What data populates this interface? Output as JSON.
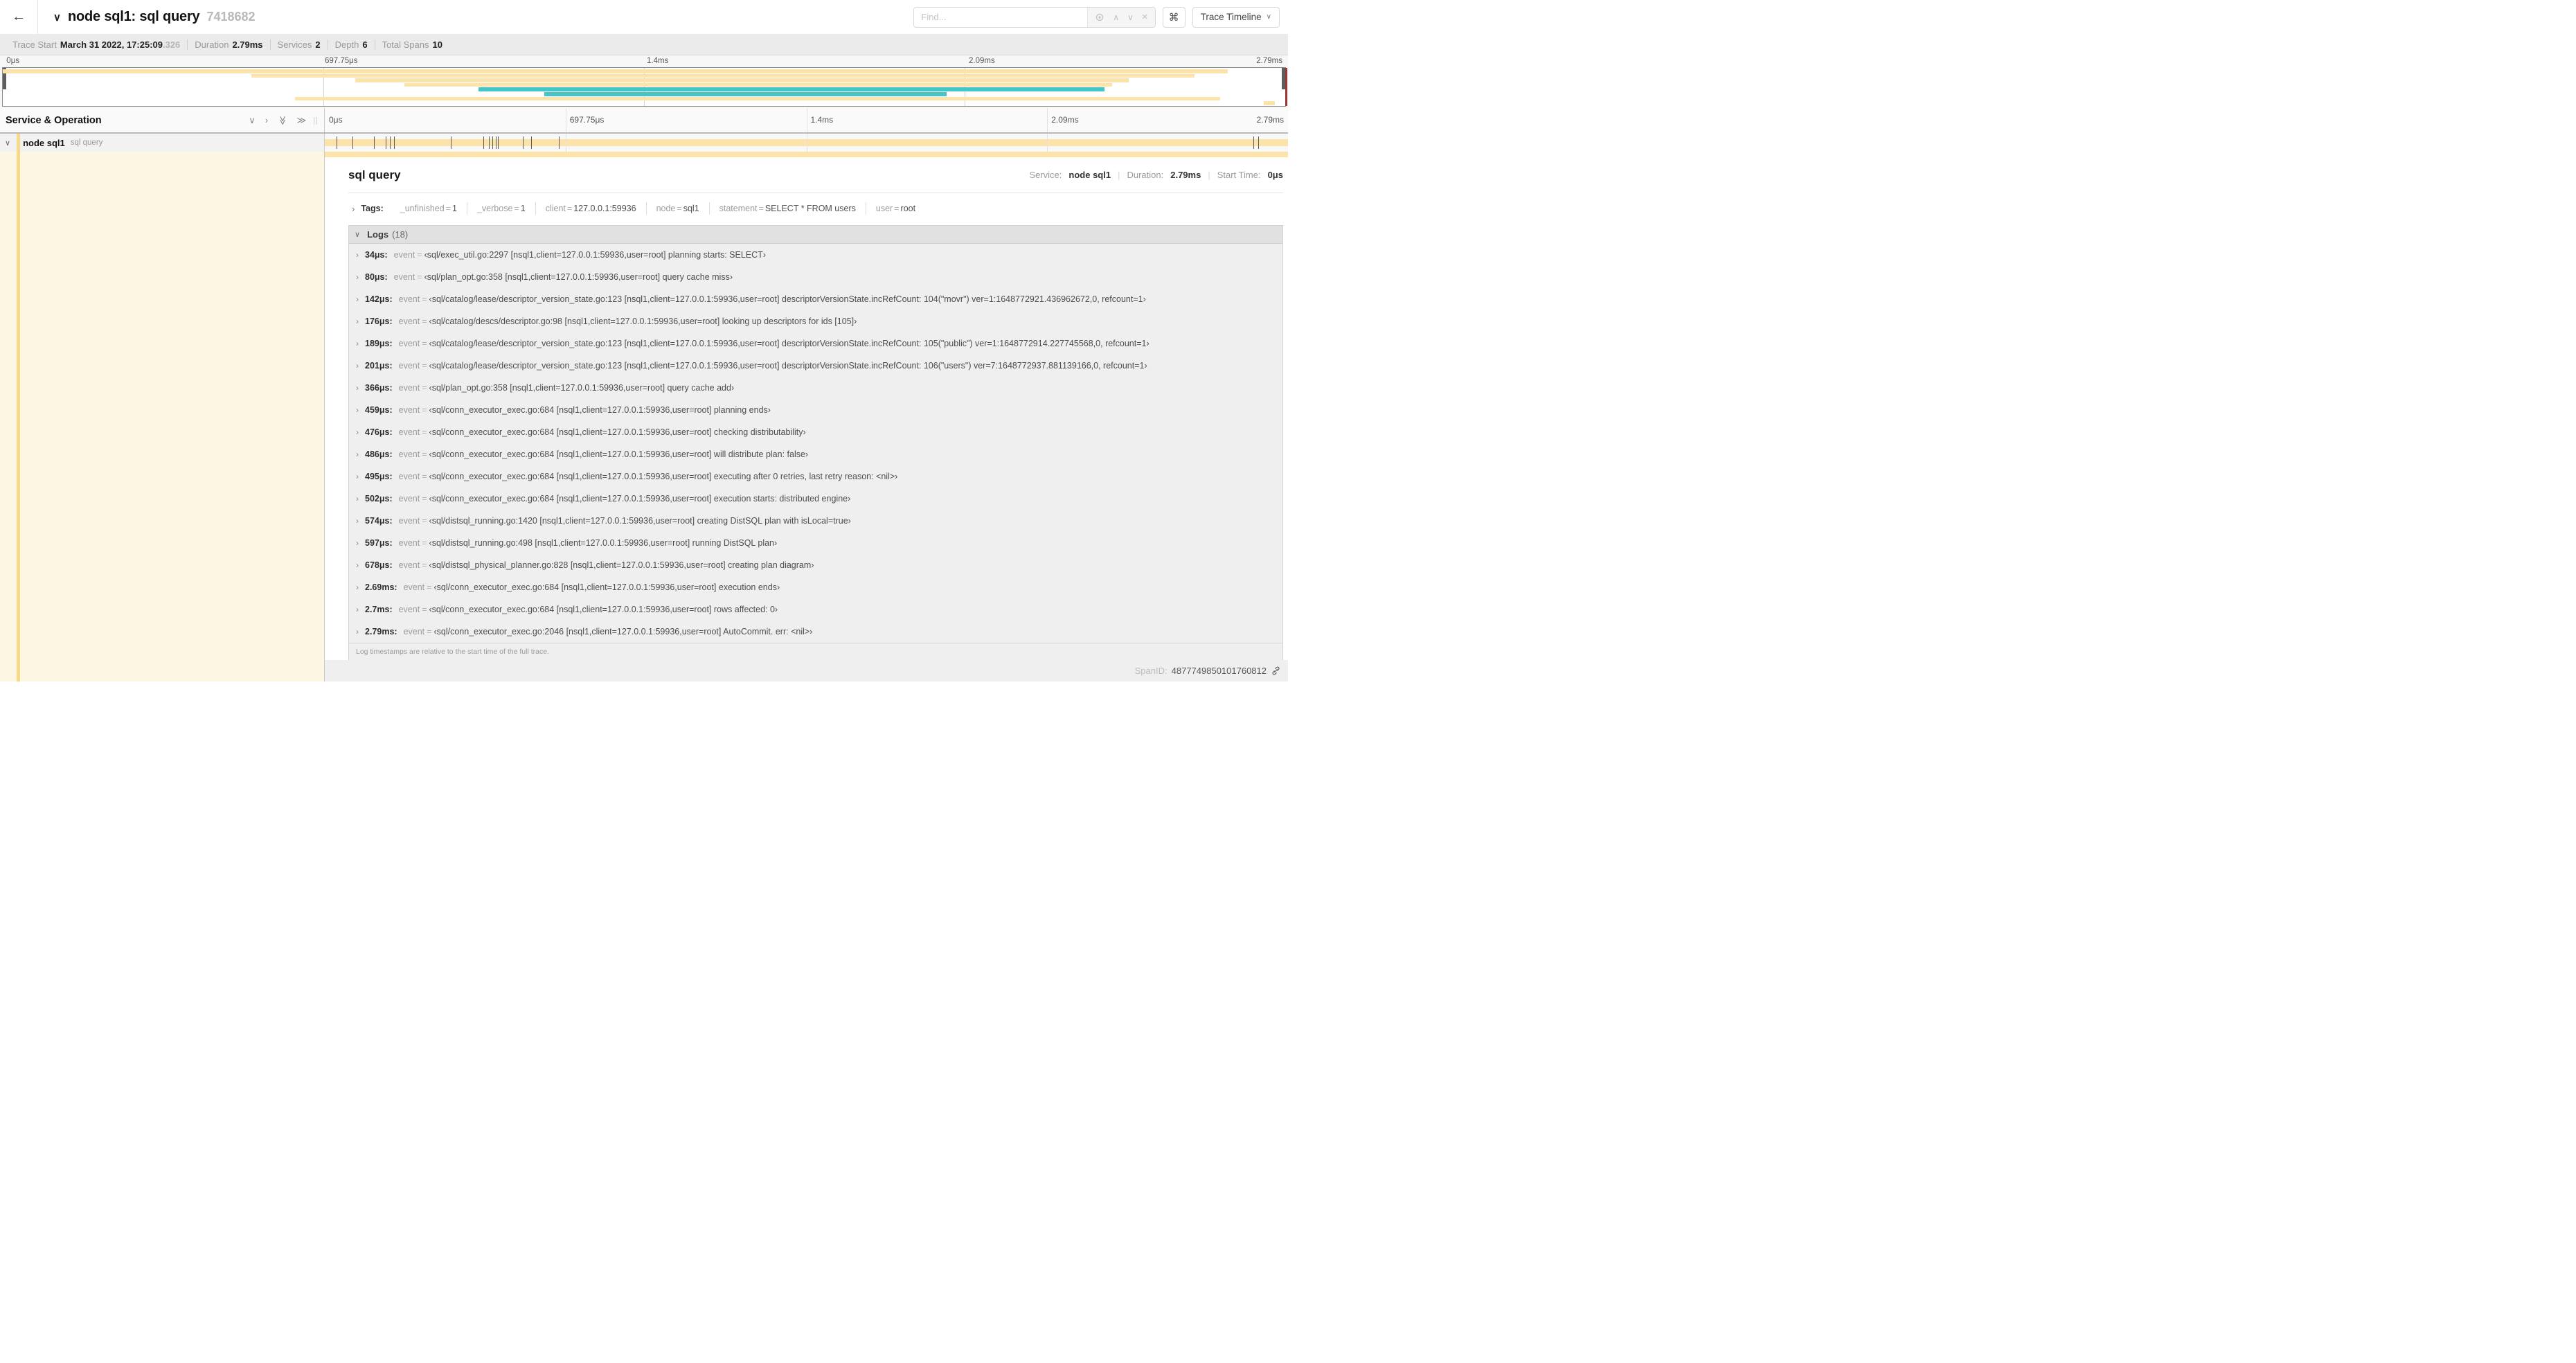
{
  "header": {
    "back_icon": "arrow-left",
    "collapse_icon": "chevron-down",
    "title": "node sql1: sql query",
    "trace_id_short": "7418682",
    "find_placeholder": "Find...",
    "locate_icon": "locate-target",
    "prev_icon": "chevron-up",
    "next_icon": "chevron-down",
    "clear_icon": "close-x",
    "shortcut_label": "⌘",
    "view_select_label": "Trace Timeline",
    "view_select_chevron": "∨"
  },
  "summary": {
    "trace_start_label": "Trace Start",
    "trace_start_value": "March 31 2022, 17:25:09",
    "trace_start_fraction": ".326",
    "duration_label": "Duration",
    "duration_value": "2.79ms",
    "services_label": "Services",
    "services_value": "2",
    "depth_label": "Depth",
    "depth_value": "6",
    "total_spans_label": "Total Spans",
    "total_spans_value": "10"
  },
  "timeline": {
    "ticks": [
      {
        "label": "0μs",
        "pos": 0
      },
      {
        "label": "697.75μs",
        "pos": 25
      },
      {
        "label": "1.4ms",
        "pos": 50
      },
      {
        "label": "2.09ms",
        "pos": 75
      },
      {
        "label": "2.79ms",
        "pos": 100
      }
    ],
    "gridline_positions": [
      25,
      50,
      75
    ],
    "colors": {
      "span_tan": "#fce3a9",
      "span_teal": "#44c6c6",
      "accent_tan": "#f7d98c"
    },
    "minimap_spans": [
      {
        "row": 0,
        "start": 0,
        "end": 95.5,
        "color": "#fce3a9"
      },
      {
        "row": 1,
        "start": 19.4,
        "end": 92.9,
        "color": "#fce3a9"
      },
      {
        "row": 2,
        "start": 27.5,
        "end": 87.8,
        "color": "#fce3a9"
      },
      {
        "row": 3,
        "start": 31.3,
        "end": 86.5,
        "color": "#fce3a9"
      },
      {
        "row": 4,
        "start": 37.1,
        "end": 85.9,
        "color": "#44c6c6"
      },
      {
        "row": 5,
        "start": 42.2,
        "end": 73.6,
        "color": "#44c6c6"
      },
      {
        "row": 6,
        "start": 22.8,
        "end": 94.9,
        "color": "#fce3a9"
      },
      {
        "row": 7,
        "start": 98.3,
        "end": 99.2,
        "color": "#fce3a9"
      }
    ],
    "event_tick_percents": [
      1.22,
      2.87,
      5.09,
      6.31,
      6.77,
      7.2,
      13.12,
      16.45,
      17.06,
      17.42,
      17.74,
      18.0,
      20.57,
      21.4,
      24.3,
      96.4,
      96.9
    ]
  },
  "service_column": {
    "header": "Service & Operation",
    "icon_collapse_one": "chevron-down",
    "icon_expand_one": "chevron-right",
    "icon_collapse_all": "double-chevron-down",
    "icon_expand_all": "double-chevron-right",
    "service": "node sql1",
    "operation": "sql query"
  },
  "detail": {
    "title": "sql query",
    "service_label": "Service:",
    "service_value": "node sql1",
    "duration_label": "Duration:",
    "duration_value": "2.79ms",
    "start_label": "Start Time:",
    "start_value": "0μs",
    "tags_label": "Tags:",
    "tags": [
      {
        "key": "_unfinished",
        "value": "1"
      },
      {
        "key": "_verbose",
        "value": "1"
      },
      {
        "key": "client",
        "value": "127.0.0.1:59936"
      },
      {
        "key": "node",
        "value": "sql1"
      },
      {
        "key": "statement",
        "value": "SELECT * FROM users"
      },
      {
        "key": "user",
        "value": "root"
      }
    ],
    "logs_label": "Logs",
    "logs_count": "(18)",
    "logs": [
      {
        "t": "34μs:",
        "key": "event",
        "value": "‹sql/exec_util.go:2297 [nsql1,client=127.0.0.1:59936,user=root] planning starts: SELECT›"
      },
      {
        "t": "80μs:",
        "key": "event",
        "value": "‹sql/plan_opt.go:358 [nsql1,client=127.0.0.1:59936,user=root] query cache miss›"
      },
      {
        "t": "142μs:",
        "key": "event",
        "value": "‹sql/catalog/lease/descriptor_version_state.go:123 [nsql1,client=127.0.0.1:59936,user=root] descriptorVersionState.incRefCount: 104(\"movr\") ver=1:1648772921.436962672,0, refcount=1›"
      },
      {
        "t": "176μs:",
        "key": "event",
        "value": "‹sql/catalog/descs/descriptor.go:98 [nsql1,client=127.0.0.1:59936,user=root] looking up descriptors for ids [105]›"
      },
      {
        "t": "189μs:",
        "key": "event",
        "value": "‹sql/catalog/lease/descriptor_version_state.go:123 [nsql1,client=127.0.0.1:59936,user=root] descriptorVersionState.incRefCount: 105(\"public\") ver=1:1648772914.227745568,0, refcount=1›"
      },
      {
        "t": "201μs:",
        "key": "event",
        "value": "‹sql/catalog/lease/descriptor_version_state.go:123 [nsql1,client=127.0.0.1:59936,user=root] descriptorVersionState.incRefCount: 106(\"users\") ver=7:1648772937.881139166,0, refcount=1›"
      },
      {
        "t": "366μs:",
        "key": "event",
        "value": "‹sql/plan_opt.go:358 [nsql1,client=127.0.0.1:59936,user=root] query cache add›"
      },
      {
        "t": "459μs:",
        "key": "event",
        "value": "‹sql/conn_executor_exec.go:684 [nsql1,client=127.0.0.1:59936,user=root] planning ends›"
      },
      {
        "t": "476μs:",
        "key": "event",
        "value": "‹sql/conn_executor_exec.go:684 [nsql1,client=127.0.0.1:59936,user=root] checking distributability›"
      },
      {
        "t": "486μs:",
        "key": "event",
        "value": "‹sql/conn_executor_exec.go:684 [nsql1,client=127.0.0.1:59936,user=root] will distribute plan: false›"
      },
      {
        "t": "495μs:",
        "key": "event",
        "value": "‹sql/conn_executor_exec.go:684 [nsql1,client=127.0.0.1:59936,user=root] executing after 0 retries, last retry reason: <nil>›"
      },
      {
        "t": "502μs:",
        "key": "event",
        "value": "‹sql/conn_executor_exec.go:684 [nsql1,client=127.0.0.1:59936,user=root] execution starts: distributed engine›"
      },
      {
        "t": "574μs:",
        "key": "event",
        "value": "‹sql/distsql_running.go:1420 [nsql1,client=127.0.0.1:59936,user=root] creating DistSQL plan with isLocal=true›"
      },
      {
        "t": "597μs:",
        "key": "event",
        "value": "‹sql/distsql_running.go:498 [nsql1,client=127.0.0.1:59936,user=root] running DistSQL plan›"
      },
      {
        "t": "678μs:",
        "key": "event",
        "value": "‹sql/distsql_physical_planner.go:828 [nsql1,client=127.0.0.1:59936,user=root] creating plan diagram›"
      },
      {
        "t": "2.69ms:",
        "key": "event",
        "value": "‹sql/conn_executor_exec.go:684 [nsql1,client=127.0.0.1:59936,user=root] execution ends›"
      },
      {
        "t": "2.7ms:",
        "key": "event",
        "value": "‹sql/conn_executor_exec.go:684 [nsql1,client=127.0.0.1:59936,user=root] rows affected: 0›"
      },
      {
        "t": "2.79ms:",
        "key": "event",
        "value": "‹sql/conn_executor_exec.go:2046 [nsql1,client=127.0.0.1:59936,user=root] AutoCommit. err: <nil>›"
      }
    ],
    "logs_note": "Log timestamps are relative to the start time of the full trace.",
    "span_id_label": "SpanID:",
    "span_id_value": "4877749850101760812"
  }
}
